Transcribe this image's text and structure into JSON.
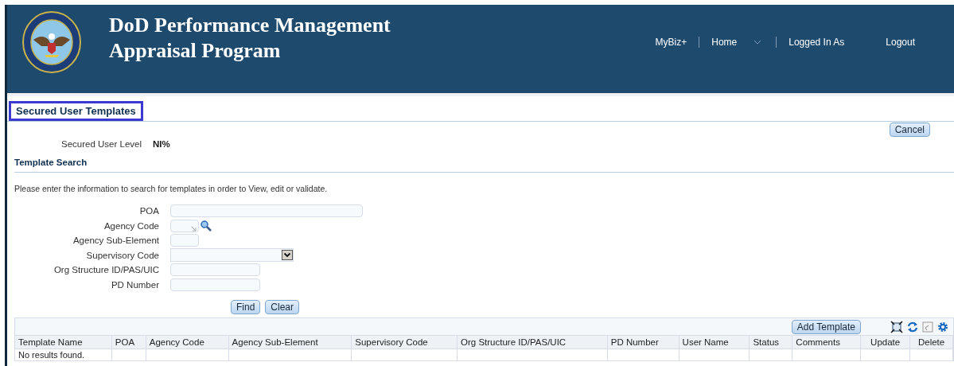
{
  "header": {
    "title_lines": [
      "DoD Performance Management",
      "Appraisal Program"
    ],
    "nav": [
      {
        "label": "MyBiz+",
        "menu": false,
        "divider_after": true
      },
      {
        "label": "Home",
        "menu": true,
        "divider_after": true
      },
      {
        "label": "Logged In As",
        "menu": false,
        "divider_after": false
      },
      {
        "label": "Logout",
        "menu": false,
        "divider_after": false
      }
    ]
  },
  "page_title": {
    "text": "Secured User Templates",
    "highlighted": true
  },
  "cancel_button": "Cancel",
  "secured_user_level": {
    "label": "Secured User Level",
    "value": "NI%"
  },
  "section_title": "Template Search",
  "instructions": "Please enter the information to search for templates in order to View, edit or validate.",
  "fields": [
    {
      "label": "POA",
      "kind": "text"
    },
    {
      "label": "Agency Code",
      "kind": "lov"
    },
    {
      "label": "Agency Sub-Element",
      "kind": "text"
    },
    {
      "label": "Supervisory Code",
      "kind": "select"
    },
    {
      "label": "Org Structure ID/PAS/UIC",
      "kind": "text"
    },
    {
      "label": "PD Number",
      "kind": "text"
    }
  ],
  "search_buttons": [
    "Find",
    "Clear"
  ],
  "table": {
    "add_button": "Add Template",
    "columns": [
      "Template Name",
      "POA",
      "Agency Code",
      "Agency Sub-Element",
      "Supervisory Code",
      "Org Structure ID/PAS/UIC",
      "PD Number",
      "User Name",
      "Status",
      "Comments",
      "Update",
      "Delete"
    ],
    "empty_message": "No results found."
  }
}
